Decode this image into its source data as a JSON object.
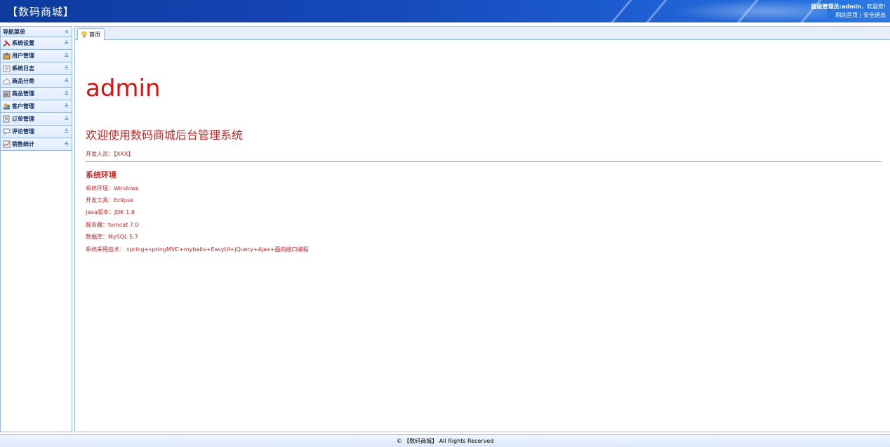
{
  "header": {
    "brand": "【数码商城】",
    "greeting_prefix": "超级管理员:",
    "user": "admin",
    "greeting_suffix": "，欢迎您!",
    "link_home": "网站首页",
    "link_sep": " | ",
    "link_logout": "安全退出"
  },
  "sidebar": {
    "title": "导航菜单",
    "collapse_glyph": "«",
    "items": [
      {
        "label": "系统设置",
        "icon": "tools-icon"
      },
      {
        "label": "用户管理",
        "icon": "users-icon"
      },
      {
        "label": "系统日志",
        "icon": "log-icon"
      },
      {
        "label": "商品分类",
        "icon": "category-icon"
      },
      {
        "label": "商品管理",
        "icon": "product-icon"
      },
      {
        "label": "客户管理",
        "icon": "customer-icon"
      },
      {
        "label": "订单管理",
        "icon": "order-icon"
      },
      {
        "label": "评论管理",
        "icon": "comment-icon"
      },
      {
        "label": "销售统计",
        "icon": "chart-icon"
      }
    ]
  },
  "tabs": [
    {
      "label": "首页",
      "icon": "bulb-icon"
    }
  ],
  "home": {
    "big_user": "admin",
    "welcome": "欢迎使用数码商城后台管理系统",
    "developer": "开发人员：【XXX】",
    "env_title": "系统环境",
    "env_lines": [
      "系统环境：Windows",
      "开发工具：Eclipse",
      "Java版本：JDK 1.8",
      "服务器：tomcat 7.0",
      "数据库：MySQL 5.7",
      "系统采用技术： spring+springMVC+mybaits+EasyUI+jQuery+Ajax+面向接口编程"
    ]
  },
  "footer": {
    "text": "© 【数码商城】 All Rights Reserved"
  },
  "colors": {
    "accent_red": "#d42020",
    "header_blue": "#1547b8",
    "border_blue": "#95b8e7"
  }
}
